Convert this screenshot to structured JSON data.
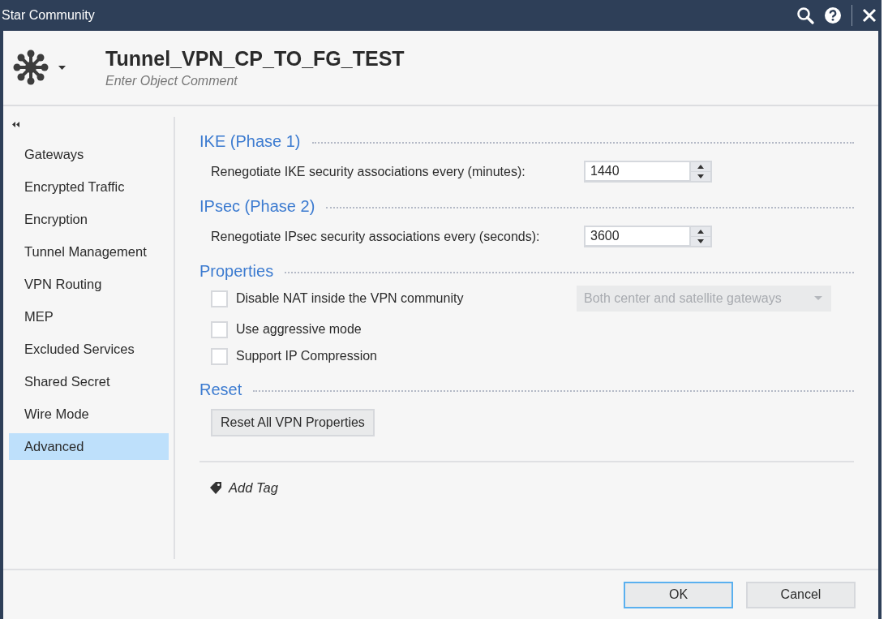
{
  "window": {
    "title": "Star Community"
  },
  "header": {
    "object_name": "Tunnel_VPN_CP_TO_FG_TEST",
    "comment_placeholder": "Enter Object Comment"
  },
  "sidebar": {
    "items": [
      {
        "label": "Gateways",
        "selected": false
      },
      {
        "label": "Encrypted Traffic",
        "selected": false
      },
      {
        "label": "Encryption",
        "selected": false
      },
      {
        "label": "Tunnel Management",
        "selected": false
      },
      {
        "label": "VPN Routing",
        "selected": false
      },
      {
        "label": "MEP",
        "selected": false
      },
      {
        "label": "Excluded Services",
        "selected": false
      },
      {
        "label": "Shared Secret",
        "selected": false
      },
      {
        "label": "Wire Mode",
        "selected": false
      },
      {
        "label": "Advanced",
        "selected": true
      }
    ]
  },
  "sections": [
    {
      "kind": "field",
      "title": "IKE (Phase 1)",
      "label": "Renegotiate IKE security associations every (minutes):",
      "value": "1440"
    },
    {
      "kind": "field",
      "title": "IPsec (Phase 2)",
      "label": "Renegotiate IPsec security associations every (seconds):",
      "value": "3600"
    },
    {
      "kind": "checkboxes",
      "title": "Properties",
      "options": [
        {
          "label": "Disable NAT inside the VPN community",
          "checked": false
        },
        {
          "label": "Use aggressive mode",
          "checked": false
        },
        {
          "label": "Support IP Compression",
          "checked": false
        }
      ],
      "dropdown": {
        "value": "Both center and satellite gateways",
        "disabled": true
      }
    },
    {
      "kind": "button",
      "title": "Reset",
      "button": "Reset All VPN Properties"
    }
  ],
  "add_tag": "Add Tag",
  "buttons": [
    {
      "label": "OK",
      "default": true
    },
    {
      "label": "Cancel",
      "default": false
    }
  ]
}
